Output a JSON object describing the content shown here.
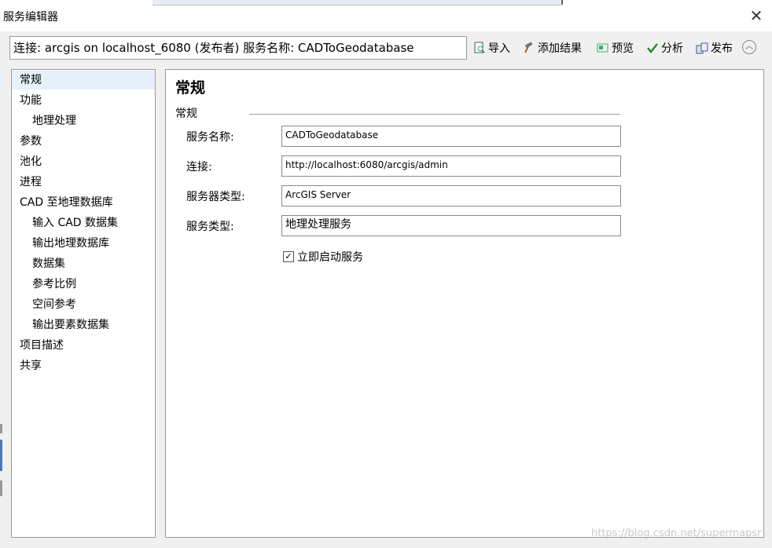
{
  "window": {
    "title": "服务编辑器",
    "close_label": "✕"
  },
  "connection_text": "连接: arcgis on localhost_6080 (发布者)   服务名称: CADToGeodatabase",
  "toolbar": {
    "import_label": "导入",
    "add_result_label": "添加结果",
    "preview_label": "预览",
    "analyze_label": "分析",
    "publish_label": "发布",
    "collapse_label": "︿"
  },
  "nav": {
    "items": [
      {
        "label": "常规"
      },
      {
        "label": "功能"
      },
      {
        "label": "地理处理"
      },
      {
        "label": "参数"
      },
      {
        "label": "池化"
      },
      {
        "label": "进程"
      },
      {
        "label": "CAD 至地理数据库"
      },
      {
        "label": "输入 CAD 数据集"
      },
      {
        "label": "输出地理数据库"
      },
      {
        "label": "数据集"
      },
      {
        "label": "参考比例"
      },
      {
        "label": "空间参考"
      },
      {
        "label": "输出要素数据集"
      },
      {
        "label": "项目描述"
      },
      {
        "label": "共享"
      }
    ]
  },
  "panel": {
    "title": "常规",
    "group_label": "常规",
    "fields": [
      {
        "label": "服务名称:",
        "value": "CADToGeodatabase"
      },
      {
        "label": "连接:",
        "value": "http://localhost:6080/arcgis/admin"
      },
      {
        "label": "服务器类型:",
        "value": "ArcGIS Server"
      },
      {
        "label": "服务类型:",
        "value": "地理处理服务"
      }
    ],
    "start_service": {
      "label": "立即启动服务",
      "checked": true,
      "check_glyph": "✓"
    }
  },
  "watermark": "https://blog.csdn.net/supermapsr"
}
